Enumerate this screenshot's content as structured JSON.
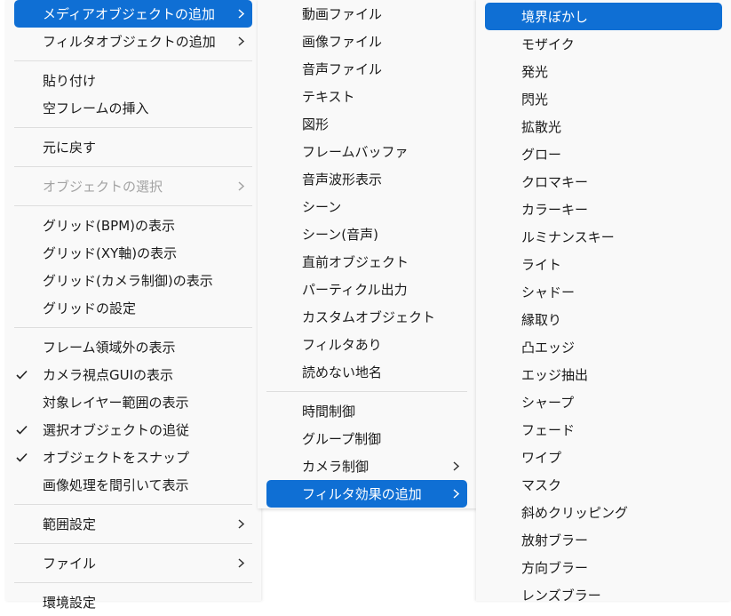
{
  "menu_main": {
    "items": [
      {
        "label": "メディアオブジェクトの追加",
        "submenu": true,
        "highlight": true
      },
      {
        "label": "フィルタオブジェクトの追加",
        "submenu": true
      },
      {
        "separator": true
      },
      {
        "label": "貼り付け"
      },
      {
        "label": "空フレームの挿入"
      },
      {
        "separator": true
      },
      {
        "label": "元に戻す"
      },
      {
        "separator": true
      },
      {
        "label": "オブジェクトの選択",
        "submenu": true,
        "disabled": true
      },
      {
        "separator": true
      },
      {
        "label": "グリッド(BPM)の表示"
      },
      {
        "label": "グリッド(XY軸)の表示"
      },
      {
        "label": "グリッド(カメラ制御)の表示"
      },
      {
        "label": "グリッドの設定"
      },
      {
        "separator": true
      },
      {
        "label": "フレーム領域外の表示"
      },
      {
        "label": "カメラ視点GUIの表示",
        "checked": true
      },
      {
        "label": "対象レイヤー範囲の表示"
      },
      {
        "label": "選択オブジェクトの追従",
        "checked": true
      },
      {
        "label": "オブジェクトをスナップ",
        "checked": true
      },
      {
        "label": "画像処理を間引いて表示"
      },
      {
        "separator": true
      },
      {
        "label": "範囲設定",
        "submenu": true
      },
      {
        "separator": true
      },
      {
        "label": "ファイル",
        "submenu": true
      },
      {
        "separator": true
      },
      {
        "label": "環境設定"
      }
    ]
  },
  "menu_media": {
    "items": [
      {
        "label": "動画ファイル"
      },
      {
        "label": "画像ファイル"
      },
      {
        "label": "音声ファイル"
      },
      {
        "label": "テキスト"
      },
      {
        "label": "図形"
      },
      {
        "label": "フレームバッファ"
      },
      {
        "label": "音声波形表示"
      },
      {
        "label": "シーン"
      },
      {
        "label": "シーン(音声)"
      },
      {
        "label": "直前オブジェクト"
      },
      {
        "label": "パーティクル出力"
      },
      {
        "label": "カスタムオブジェクト"
      },
      {
        "label": "フィルタあり"
      },
      {
        "label": "読めない地名"
      },
      {
        "separator": true
      },
      {
        "label": "時間制御"
      },
      {
        "label": "グループ制御"
      },
      {
        "label": "カメラ制御",
        "submenu": true
      },
      {
        "label": "フィルタ効果の追加",
        "submenu": true,
        "highlight": true
      }
    ]
  },
  "menu_filter": {
    "items": [
      {
        "label": "境界ぼかし",
        "highlight": true
      },
      {
        "label": "モザイク"
      },
      {
        "label": "発光"
      },
      {
        "label": "閃光"
      },
      {
        "label": "拡散光"
      },
      {
        "label": "グロー"
      },
      {
        "label": "クロマキー"
      },
      {
        "label": "カラーキー"
      },
      {
        "label": "ルミナンスキー"
      },
      {
        "label": "ライト"
      },
      {
        "label": "シャドー"
      },
      {
        "label": "縁取り"
      },
      {
        "label": "凸エッジ"
      },
      {
        "label": "エッジ抽出"
      },
      {
        "label": "シャープ"
      },
      {
        "label": "フェード"
      },
      {
        "label": "ワイプ"
      },
      {
        "label": "マスク"
      },
      {
        "label": "斜めクリッピング"
      },
      {
        "label": "放射ブラー"
      },
      {
        "label": "方向ブラー"
      },
      {
        "label": "レンズブラー"
      }
    ]
  },
  "colors": {
    "highlight": "#0f6fd4",
    "menu_bg": "#f9f9f9",
    "disabled_text": "#a3a3a3"
  },
  "icons": {
    "check": "checkmark-icon",
    "submenu": "chevron-right-icon"
  }
}
